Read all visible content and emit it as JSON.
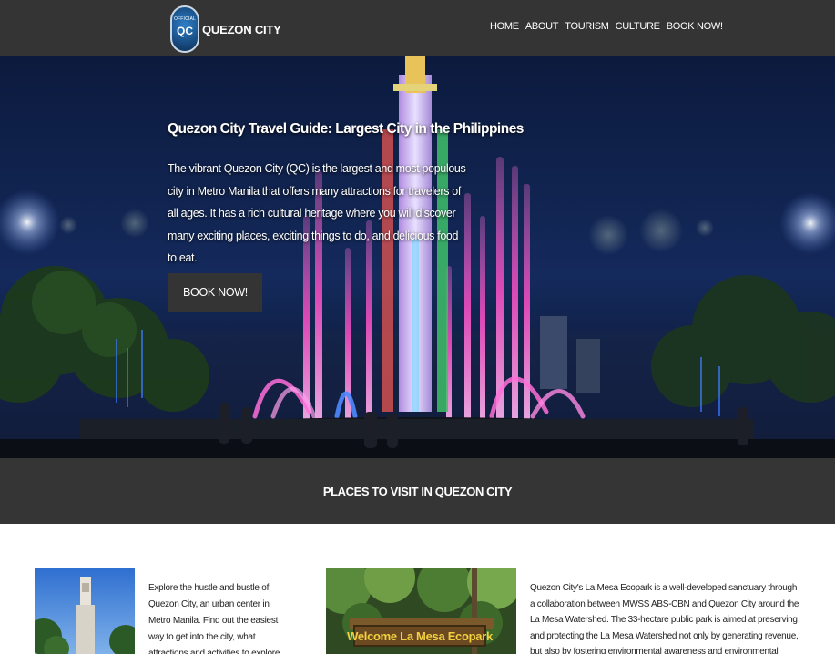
{
  "header": {
    "logo_badge_small": "OFFICIAL",
    "logo_badge_main": "QC",
    "site_name": "QUEZON CITY",
    "nav": [
      "HOME",
      "ABOUT",
      "TOURISM",
      "CULTURE",
      "BOOK NOW!"
    ]
  },
  "hero": {
    "title": "Quezon City Travel Guide: Largest City in the Philippines",
    "description": "The vibrant Quezon City (QC) is the largest and most populous city in Metro Manila that offers many attractions for travelers of all ages. It has a rich cultural heritage where you will discover many exciting places, exciting things to do, and delicious food to eat.",
    "button_label": "BOOK NOW!"
  },
  "places": {
    "title": "PLACES TO VISIT IN QUEZON CITY"
  },
  "cards": [
    {
      "text": "Explore the hustle and bustle of Quezon City, an urban center in Metro Manila. Find out the easiest way to get into the city, what attractions and activities to explore."
    },
    {
      "sign_text": "Welcome La Mesa Ecopark",
      "text": "Quezon City's La Mesa Ecopark is a well-developed sanctuary through a collaboration between MWSS ABS-CBN and Quezon City around the La Mesa Watershed. The 33-hectare public park is aimed at preserving and protecting the La Mesa Watershed not only by generating revenue, but also by fostering environmental awareness and environmental conservation. The EcoPark's"
    }
  ],
  "colors": {
    "nav_bg": "#343434",
    "banner_bg": "#353535",
    "button_bg": "#343434",
    "text_light": "#ffffff",
    "text_dark": "#222222"
  }
}
